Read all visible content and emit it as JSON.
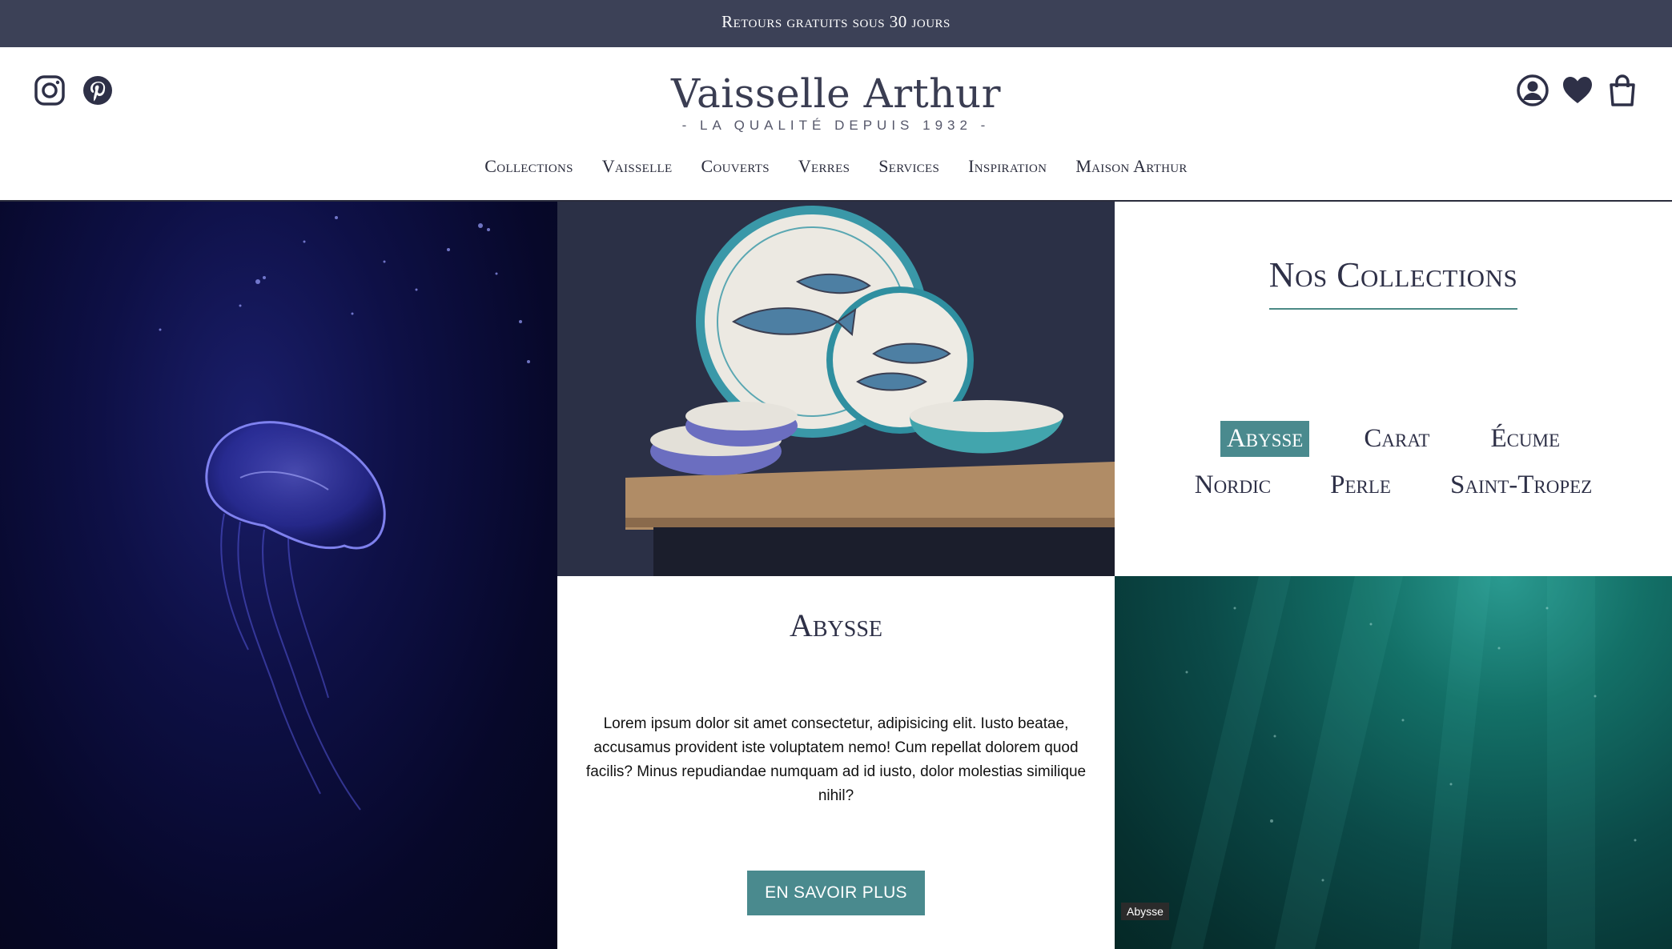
{
  "announcement": "Retours gratuits sous 30 jours",
  "header": {
    "brand_title": "Vaisselle Arthur",
    "brand_subtitle": "- LA QUALITÉ DEPUIS 1932 -",
    "social_icons": [
      "instagram-icon",
      "pinterest-icon"
    ],
    "user_icons": [
      "account-icon",
      "wishlist-heart-icon",
      "cart-bag-icon"
    ]
  },
  "nav": {
    "items": [
      "Collections",
      "Vaisselle",
      "Couverts",
      "Verres",
      "Services",
      "Inspiration",
      "Maison Arthur"
    ]
  },
  "collections": {
    "title": "Nos Collections",
    "row1": [
      "Abysse",
      "Carat",
      "Écume"
    ],
    "row2": [
      "Nordic",
      "Perle",
      "Saint-Tropez"
    ],
    "active": "Abysse"
  },
  "feature": {
    "title": "Abysse",
    "text": "Lorem ipsum dolor sit amet consectetur, adipisicing elit. Iusto beatae, accusamus provident iste voluptatem nemo! Cum repellat dolorem quod facilis? Minus repudiandae numquam ad id iusto, dolor molestias similique nihil?",
    "cta": "EN SAVOIR PLUS"
  },
  "image_caption": "Abysse",
  "colors": {
    "topbar": "#3c4157",
    "accent": "#4a8a8e",
    "text_dark": "#2e3047"
  }
}
